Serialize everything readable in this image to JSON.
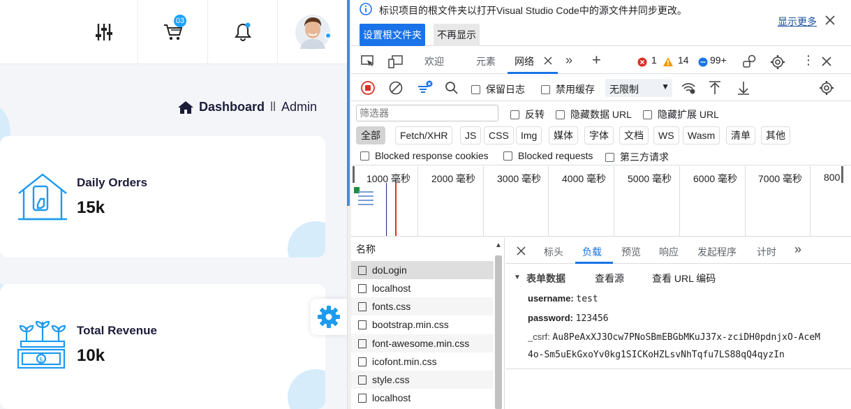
{
  "app": {
    "breadcrumb": {
      "page": "Dashboard",
      "separator": "ll",
      "role": "Admin"
    },
    "cart_badge": "03",
    "cards": [
      {
        "title": "Daily Orders",
        "value": "15k",
        "icon": "home-phone-icon"
      },
      {
        "title": "Total Revenue",
        "value": "10k",
        "icon": "money-plant-icon"
      }
    ],
    "colors": {
      "accent": "#1fa2ff",
      "circle": "#d6ecfb",
      "text": "#1c1c3a"
    }
  },
  "devtools": {
    "info_message": "标识项目的根文件夹以打开Visual Studio Code中的源文件并同步更改。",
    "show_more": "显示更多",
    "set_root_button": "设置根文件夹",
    "dont_show_button": "不再显示",
    "tabs": [
      "欢迎",
      "元素",
      "网络"
    ],
    "errors": "1",
    "warnings": "14",
    "messages": "99+",
    "toolbar": {
      "preserve_log": "保留日志",
      "disable_cache": "禁用缓存",
      "throttle": "无限制"
    },
    "filter": {
      "placeholder": "筛选器",
      "invert": "反转",
      "hide_data_urls": "隐藏数据 URL",
      "hide_ext_urls": "隐藏扩展 URL"
    },
    "types": [
      "全部",
      "Fetch/XHR",
      "JS",
      "CSS",
      "Img",
      "媒体",
      "字体",
      "文档",
      "WS",
      "Wasm",
      "清单",
      "其他"
    ],
    "blocked": {
      "cookies": "Blocked response cookies",
      "requests": "Blocked requests",
      "third_party": "第三方请求"
    },
    "timeline": {
      "labels": [
        "1000 毫秒",
        "2000 毫秒",
        "3000 毫秒",
        "4000 毫秒",
        "5000 毫秒",
        "6000 毫秒",
        "7000 毫秒",
        "800"
      ]
    },
    "requests_header": "名称",
    "requests": [
      "doLogin",
      "localhost",
      "fonts.css",
      "bootstrap.min.css",
      "font-awesome.min.css",
      "icofont.min.css",
      "style.css",
      "localhost"
    ],
    "detail_tabs": [
      "标头",
      "负载",
      "预览",
      "响应",
      "发起程序",
      "计时"
    ],
    "payload": {
      "section": "表单数据",
      "view_source": "查看源",
      "view_url_encoded": "查看 URL 编码",
      "fields": [
        {
          "key": "username:",
          "value": "test"
        },
        {
          "key": "password:",
          "value": "123456"
        },
        {
          "key": "_csrf:",
          "value": "Au8PeAxXJ3Ocw7PNoSBmEBGbMKuJ37x-zciDH0pdnjxO-AceM"
        }
      ],
      "csrf_cont": "4o-Sm5uEkGxoYv0kg1SICKoHZLsvNhTqfu7LS88qQ4qyzIn"
    }
  }
}
